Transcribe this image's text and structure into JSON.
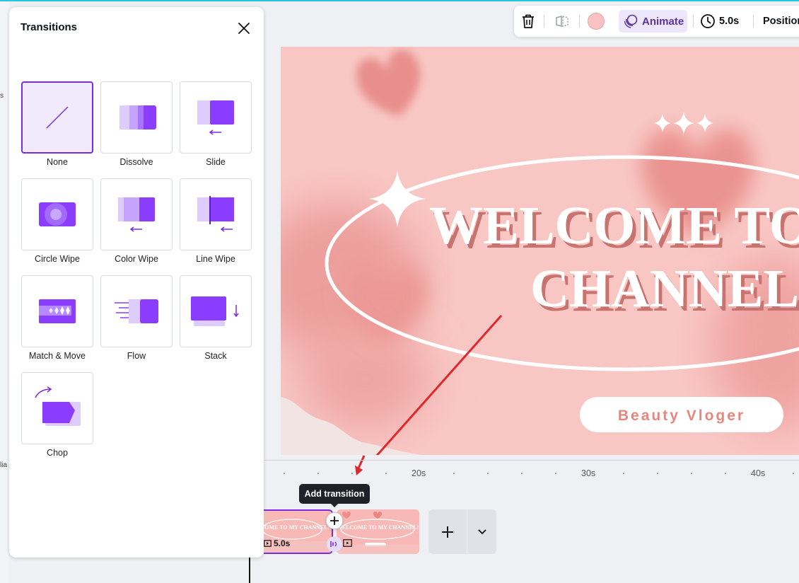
{
  "panel": {
    "title": "Transitions",
    "transitions": [
      {
        "label": "None",
        "selected": true
      },
      {
        "label": "Dissolve"
      },
      {
        "label": "Slide"
      },
      {
        "label": "Circle Wipe"
      },
      {
        "label": "Color Wipe"
      },
      {
        "label": "Line Wipe"
      },
      {
        "label": "Match & Move"
      },
      {
        "label": "Flow"
      },
      {
        "label": "Stack"
      },
      {
        "label": "Chop"
      }
    ]
  },
  "left_strip": {
    "text_1": "s",
    "text_2": "lia"
  },
  "toolbar": {
    "animate_label": "Animate",
    "duration": "5.0s",
    "position_label": "Position",
    "swatch_color": "#f9c1c1"
  },
  "canvas": {
    "headline_line1": "WELCOME TO MY",
    "headline_line2": "CHANNEL!",
    "badge_text": "Beauty Vloger"
  },
  "ruler": {
    "labels": [
      "20s",
      "30s",
      "40s"
    ]
  },
  "tooltip": "Add transition",
  "timeline": {
    "clip1_duration": "5.0s",
    "clip_text": "WELCOME TO MY CHANNEL!"
  },
  "colors": {
    "accent": "#7d2ae8",
    "canvas_bg": "#f8c7c4",
    "badge_text": "#e8857e",
    "arrow": "#e3262b"
  }
}
